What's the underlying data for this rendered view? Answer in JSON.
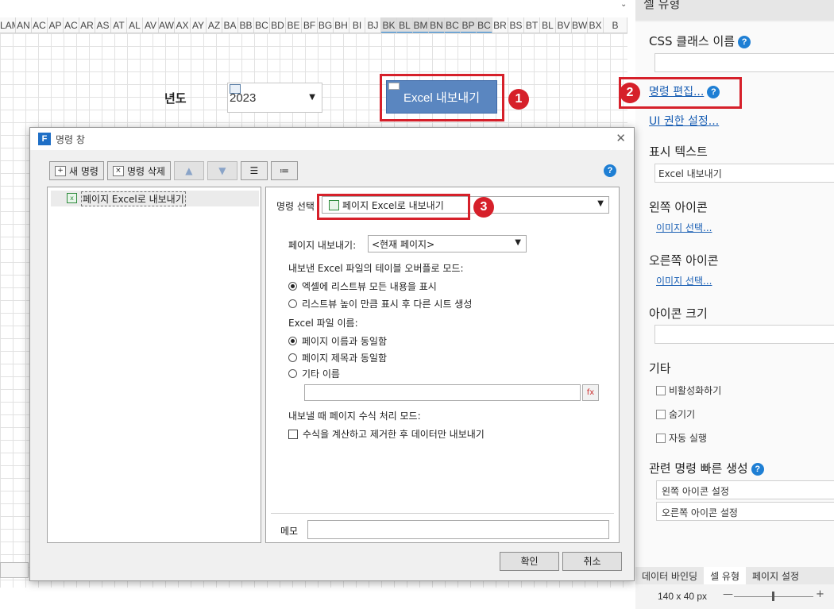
{
  "sheet": {
    "columns": [
      "LAM",
      "AN",
      "AC",
      "AP",
      "AC",
      "AR",
      "AS",
      "AT",
      "AL",
      "AV",
      "AW",
      "AX",
      "AY",
      "AZ",
      "BA",
      "BB",
      "BC",
      "BD",
      "BE",
      "BF",
      "BG",
      "BH",
      "BI",
      "BJ",
      "BK",
      "BL",
      "BM",
      "BN",
      "BC",
      "BP",
      "BC",
      "BR",
      "BS",
      "BT",
      "BL",
      "BV",
      "BW",
      "BX",
      "B"
    ],
    "selected_columns": [
      "BK",
      "BL",
      "BM",
      "BN",
      "BC",
      "BP",
      "BC"
    ],
    "year_label": "년도",
    "year_value": "2023",
    "year_arrow": "▼",
    "export_button_label": "Excel 내보내기",
    "chevron": "⌄"
  },
  "annotations": {
    "badge1": "1",
    "badge2": "2",
    "badge3": "3"
  },
  "panel": {
    "header": "셀 유형",
    "css_class_label": "CSS 클래스 이름",
    "edit_command_link": "명령 편집...",
    "ui_permission_link": "UI 권한 설정...",
    "display_text_label": "표시 텍스트",
    "display_text_value": "Excel 내보내기",
    "left_icon_label": "왼쪽 아이콘",
    "left_icon_link": "이미지 선택...",
    "right_icon_label": "오른쪽 아이콘",
    "right_icon_link": "이미지 선택...",
    "icon_size_label": "아이콘 크기",
    "other_label": "기타",
    "checks": [
      "비활성화하기",
      "숨기기",
      "자동 실행"
    ],
    "quick_label": "관련 명령 빠른 생성",
    "quick_items": [
      "왼쪽 아이콘 설정",
      "오른쪽 아이콘 설정"
    ],
    "help_glyph": "?",
    "tabs": [
      "데이터 바인딩",
      "셀 유형",
      "페이지 설정"
    ],
    "active_tab": 1,
    "zoom_text": "140 x 40 px",
    "zoom_minus": "—",
    "zoom_plus": "+"
  },
  "dialog": {
    "logo": "F",
    "title": "명령 창",
    "close": "✕",
    "toolbar": {
      "new_command": "새 명령",
      "delete_command": "명령 삭제",
      "up": "▲",
      "down": "▼"
    },
    "tree_item": "페이지 Excel로 내보내기",
    "command_select_label": "명령 선택",
    "command_select_value": "페이지 Excel로 내보내기",
    "page_export_label": "페이지 내보내기:",
    "page_export_value": "<현재 페이지>",
    "overflow_label": "내보낸 Excel 파일의 테이블 오버플로 모드:",
    "overflow_options": [
      "엑셀에 리스트뷰 모든 내용을 표시",
      "리스트뷰 높이 만큼 표시 후 다른 시트 생성"
    ],
    "overflow_selected": 0,
    "filename_label": "Excel 파일 이름:",
    "filename_options": [
      "페이지 이름과 동일함",
      "페이지 제목과 동일함",
      "기타 이름"
    ],
    "filename_selected": 0,
    "formula_label": "내보낼 때 페이지 수식 처리 모드:",
    "formula_option": "수식을 계산하고 제거한 후 데이터만 내보내기",
    "memo_label": "메모",
    "ok": "확인",
    "cancel": "취소"
  },
  "colors": {
    "accent": "#1f7fd4",
    "highlight": "#d6202a",
    "export_button": "#5a86c0"
  }
}
